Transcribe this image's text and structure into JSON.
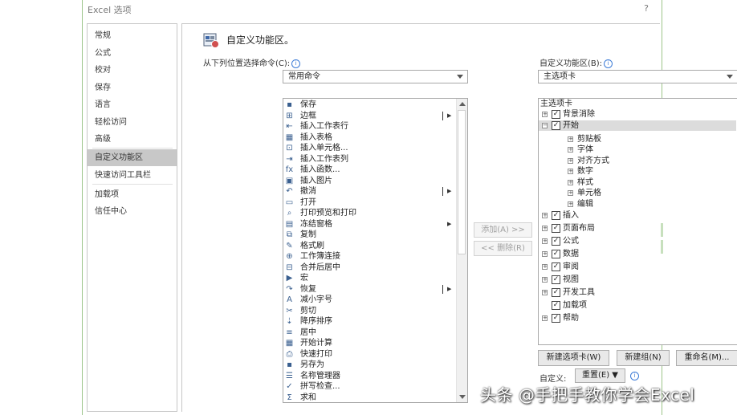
{
  "window": {
    "title": "Excel 选项",
    "help": "?"
  },
  "categories": [
    {
      "label": "常规",
      "selected": false
    },
    {
      "label": "公式",
      "selected": false
    },
    {
      "label": "校对",
      "selected": false
    },
    {
      "label": "保存",
      "selected": false
    },
    {
      "label": "语言",
      "selected": false
    },
    {
      "label": "轻松访问",
      "selected": false
    },
    {
      "label": "高级",
      "selected": false
    },
    {
      "label": "自定义功能区",
      "selected": true
    },
    {
      "label": "快速访问工具栏",
      "selected": false
    },
    {
      "label": "加载项",
      "selected": false
    },
    {
      "label": "信任中心",
      "selected": false
    }
  ],
  "header": {
    "title": "自定义功能区。"
  },
  "left": {
    "label": "从下列位置选择命令(C):",
    "combo_value": "常用命令",
    "commands": [
      {
        "label": "保存",
        "icon": "save-icon",
        "glyph": "▪"
      },
      {
        "label": "边框",
        "icon": "border-icon",
        "glyph": "⊞",
        "split": true
      },
      {
        "label": "插入工作表行",
        "icon": "insert-row-icon",
        "glyph": "⇤"
      },
      {
        "label": "插入表格",
        "icon": "insert-table-icon",
        "glyph": "▦"
      },
      {
        "label": "插入单元格...",
        "icon": "insert-cells-icon",
        "glyph": "⊡"
      },
      {
        "label": "插入工作表列",
        "icon": "insert-column-icon",
        "glyph": "⇥"
      },
      {
        "label": "插入函数...",
        "icon": "function-icon",
        "glyph": "fx"
      },
      {
        "label": "插入图片",
        "icon": "picture-icon",
        "glyph": "▣"
      },
      {
        "label": "撤消",
        "icon": "undo-icon",
        "glyph": "↶",
        "split": true
      },
      {
        "label": "打开",
        "icon": "open-folder-icon",
        "glyph": "▭"
      },
      {
        "label": "打印预览和打印",
        "icon": "print-preview-icon",
        "glyph": "⌕"
      },
      {
        "label": "冻结窗格",
        "icon": "freeze-panes-icon",
        "glyph": "▤",
        "submenu": true
      },
      {
        "label": "复制",
        "icon": "copy-icon",
        "glyph": "⧉"
      },
      {
        "label": "格式刷",
        "icon": "format-painter-icon",
        "glyph": "✎"
      },
      {
        "label": "工作簿连接",
        "icon": "connections-icon",
        "glyph": "⊕"
      },
      {
        "label": "合并后居中",
        "icon": "merge-center-icon",
        "glyph": "⊟"
      },
      {
        "label": "宏",
        "icon": "macro-icon",
        "glyph": "▶"
      },
      {
        "label": "恢复",
        "icon": "redo-icon",
        "glyph": "↷",
        "split": true
      },
      {
        "label": "减小字号",
        "icon": "decrease-font-icon",
        "glyph": "A"
      },
      {
        "label": "剪切",
        "icon": "cut-icon",
        "glyph": "✂"
      },
      {
        "label": "降序排序",
        "icon": "sort-desc-icon",
        "glyph": "⇣"
      },
      {
        "label": "居中",
        "icon": "align-center-icon",
        "glyph": "≡"
      },
      {
        "label": "开始计算",
        "icon": "calculate-icon",
        "glyph": "▦"
      },
      {
        "label": "快速打印",
        "icon": "quick-print-icon",
        "glyph": "⎙"
      },
      {
        "label": "另存为",
        "icon": "save-as-icon",
        "glyph": "▪"
      },
      {
        "label": "名称管理器",
        "icon": "name-manager-icon",
        "glyph": "☰"
      },
      {
        "label": "拼写检查...",
        "icon": "spelling-icon",
        "glyph": "✓"
      },
      {
        "label": "求和",
        "icon": "sum-icon",
        "glyph": "Σ"
      }
    ]
  },
  "middle": {
    "add_label": "添加(A) >>",
    "remove_label": "<< 删除(R)"
  },
  "right": {
    "label": "自定义功能区(B):",
    "combo_value": "主选项卡",
    "tree": [
      {
        "label": "主选项卡",
        "level": 0
      },
      {
        "label": "背景消除",
        "level": 1,
        "expander": "+",
        "checked": true
      },
      {
        "label": "开始",
        "level": 1,
        "expander": "−",
        "checked": true,
        "selected": true
      },
      {
        "label": "剪贴板",
        "level": 2,
        "expander": "+"
      },
      {
        "label": "字体",
        "level": 2,
        "expander": "+"
      },
      {
        "label": "对齐方式",
        "level": 2,
        "expander": "+"
      },
      {
        "label": "数字",
        "level": 2,
        "expander": "+"
      },
      {
        "label": "样式",
        "level": 2,
        "expander": "+"
      },
      {
        "label": "单元格",
        "level": 2,
        "expander": "+"
      },
      {
        "label": "编辑",
        "level": 2,
        "expander": "+"
      },
      {
        "label": "插入",
        "level": 1,
        "expander": "+",
        "checked": true
      },
      {
        "label": "页面布局",
        "level": 1,
        "expander": "+",
        "checked": true
      },
      {
        "label": "公式",
        "level": 1,
        "expander": "+",
        "checked": true
      },
      {
        "label": "数据",
        "level": 1,
        "expander": "+",
        "checked": true
      },
      {
        "label": "审阅",
        "level": 1,
        "expander": "+",
        "checked": true
      },
      {
        "label": "视图",
        "level": 1,
        "expander": "+",
        "checked": true
      },
      {
        "label": "开发工具",
        "level": 1,
        "expander": "+",
        "checked": true
      },
      {
        "label": "加载项",
        "level": 1,
        "checked": true
      },
      {
        "label": "帮助",
        "level": 1,
        "expander": "+",
        "checked": true
      }
    ],
    "new_tab": "新建选项卡(W)",
    "new_group": "新建组(N)",
    "rename": "重命名(M)...",
    "customize_label": "自定义:",
    "reset": "重置(E) ▼"
  },
  "watermark": "头条 @手把手教你学会Excel"
}
